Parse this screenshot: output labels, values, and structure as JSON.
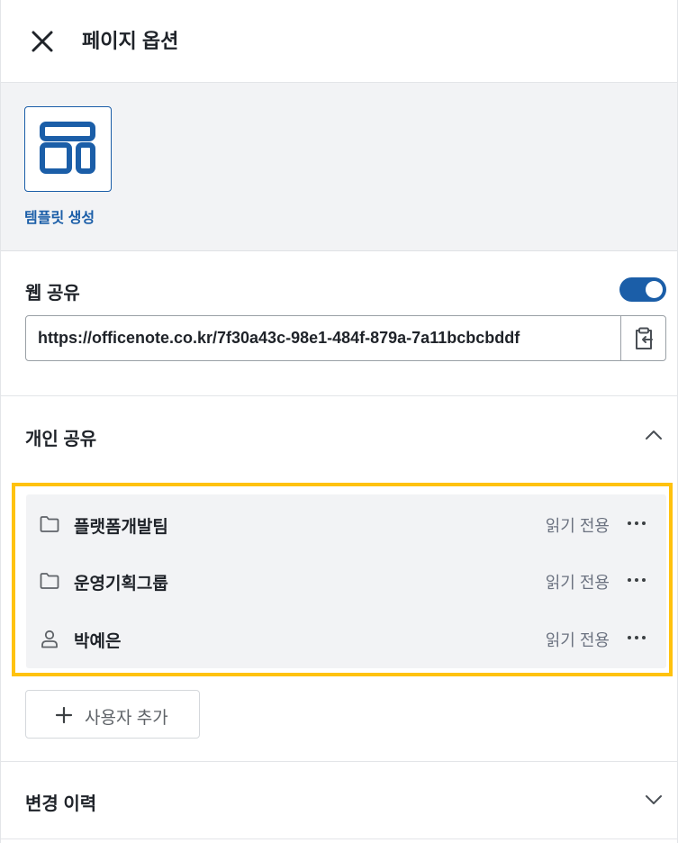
{
  "header": {
    "title": "페이지 옵션",
    "close_icon": "close-icon"
  },
  "template": {
    "label": "템플릿 생성",
    "icon": "template-icon"
  },
  "web_share": {
    "title": "웹 공유",
    "enabled": true,
    "url": "https://officenote.co.kr/7f30a43c-98e1-484f-879a-7a11bcbcbddf",
    "copy_icon": "clipboard-copy-icon"
  },
  "personal_share": {
    "title": "개인 공유",
    "expanded": true,
    "items": [
      {
        "icon": "folder-icon",
        "name": "플랫폼개발팀",
        "permission": "읽기 전용"
      },
      {
        "icon": "folder-icon",
        "name": "운영기획그룹",
        "permission": "읽기 전용"
      },
      {
        "icon": "user-icon",
        "name": "박예은",
        "permission": "읽기 전용"
      }
    ],
    "add_user_label": "사용자 추가"
  },
  "history": {
    "title": "변경 이력",
    "expanded": false
  },
  "colors": {
    "accent": "#1b5ea8",
    "highlight": "#ffc20e",
    "list_bg": "#f2f3f5"
  }
}
